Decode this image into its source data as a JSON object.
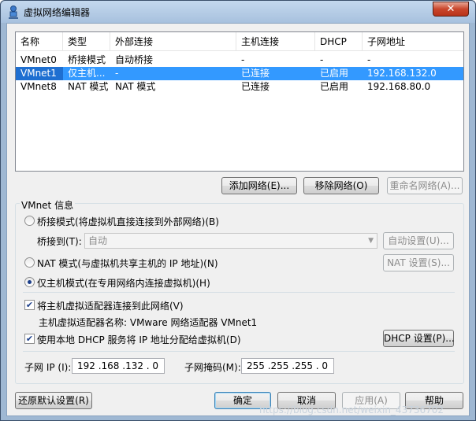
{
  "window": {
    "title": "虚拟网络编辑器",
    "close_glyph": "✕"
  },
  "table": {
    "columns": [
      "名称",
      "类型",
      "外部连接",
      "主机连接",
      "DHCP",
      "子网地址"
    ],
    "rows": [
      {
        "name": "VMnet0",
        "type": "桥接模式",
        "external": "自动桥接",
        "host": "-",
        "dhcp": "-",
        "subnet": "-",
        "selected": false
      },
      {
        "name": "VMnet1",
        "type": "仅主机...",
        "external": "-",
        "host": "已连接",
        "dhcp": "已启用",
        "subnet": "192.168.132.0",
        "selected": true
      },
      {
        "name": "VMnet8",
        "type": "NAT 模式",
        "external": "NAT 模式",
        "host": "已连接",
        "dhcp": "已启用",
        "subnet": "192.168.80.0",
        "selected": false
      }
    ]
  },
  "network_buttons": {
    "add": "添加网络(E)...",
    "remove": "移除网络(O)",
    "rename": "重命名网络(A)..."
  },
  "vmnet_info": {
    "group_label": "VMnet 信息",
    "bridge_mode": "桥接模式(将虚拟机直接连接到外部网络)(B)",
    "bridge_to_label": "桥接到(T):",
    "bridge_to_value": "自动",
    "auto_settings": "自动设置(U)...",
    "nat_mode": "NAT 模式(与虚拟机共享主机的 IP 地址)(N)",
    "nat_settings": "NAT 设置(S)...",
    "host_only_mode": "仅主机模式(在专用网络内连接虚拟机)(H)",
    "connect_adapter": "将主机虚拟适配器连接到此网络(V)",
    "adapter_name": "主机虚拟适配器名称: VMware 网络适配器 VMnet1",
    "use_dhcp": "使用本地 DHCP 服务将 IP 地址分配给虚拟机(D)",
    "dhcp_settings": "DHCP 设置(P)...",
    "subnet_ip_label": "子网 IP (I):",
    "subnet_ip_value": "192 .168 .132 . 0",
    "subnet_mask_label": "子网掩码(M):",
    "subnet_mask_value": "255 .255 .255 . 0"
  },
  "footer": {
    "restore_defaults": "还原默认设置(R)",
    "ok": "确定",
    "cancel": "取消",
    "apply": "应用(A)",
    "help": "帮助"
  },
  "watermark": "https://blog.csdn.net/weixin_43736702"
}
